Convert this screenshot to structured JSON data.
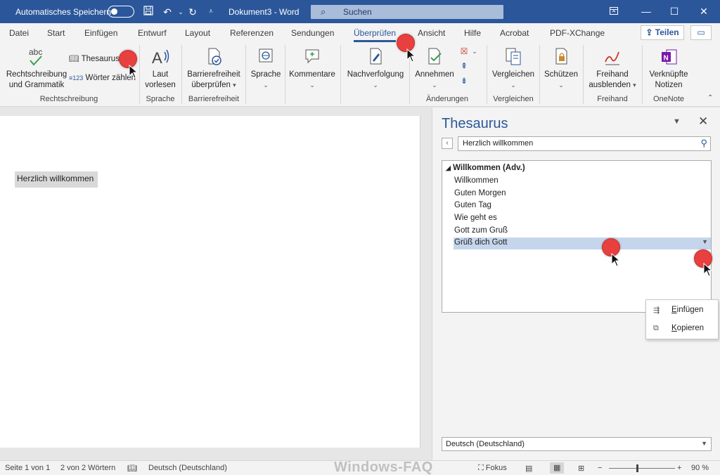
{
  "titlebar": {
    "autosave_label": "Automatisches Speichern",
    "doc_title": "Dokument3 - Word",
    "search_placeholder": "Suchen"
  },
  "tabs": [
    {
      "label": "Datei"
    },
    {
      "label": "Start"
    },
    {
      "label": "Einfügen"
    },
    {
      "label": "Entwurf"
    },
    {
      "label": "Layout"
    },
    {
      "label": "Referenzen"
    },
    {
      "label": "Sendungen"
    },
    {
      "label": "Überprüfen",
      "active": true
    },
    {
      "label": "Ansicht"
    },
    {
      "label": "Hilfe"
    },
    {
      "label": "Acrobat"
    },
    {
      "label": "PDF-XChange"
    }
  ],
  "share_label": "Teilen",
  "ribbon": {
    "spelling_line1": "Rechtschreibung",
    "spelling_line2": "und Grammatik",
    "thesaurus": "Thesaurus",
    "wordcount": "Wörter zählen",
    "read_aloud_line1": "Laut",
    "read_aloud_line2": "vorlesen",
    "accessibility_line1": "Barrierefreiheit",
    "accessibility_line2": "überprüfen",
    "language": "Sprache",
    "comments": "Kommentare",
    "tracking": "Nachverfolgung",
    "accept": "Annehmen",
    "compare": "Vergleichen",
    "protect": "Schützen",
    "ink_line1": "Freihand",
    "ink_line2": "ausblenden",
    "onenote_line1": "Verknüpfte",
    "onenote_line2": "Notizen",
    "groups": {
      "proofing": "Rechtschreibung",
      "speech": "Sprache",
      "accessibility": "Barrierefreiheit",
      "changes": "Änderungen",
      "compare": "Vergleichen",
      "ink": "Freihand",
      "onenote": "OneNote"
    }
  },
  "document": {
    "text": "Herzlich willkommen"
  },
  "thesaurus_pane": {
    "title": "Thesaurus",
    "search_value": "Herzlich willkommen",
    "heading": "Willkommen (Adv.)",
    "results": [
      "Willkommen",
      "Guten Morgen",
      "Guten Tag",
      "Wie geht es",
      "Gott zum Gruß",
      "Grüß dich Gott"
    ],
    "selected_index": 5,
    "context_menu": {
      "insert_prefix": "",
      "insert_accel": "E",
      "insert_rest": "infügen",
      "copy_accel": "K",
      "copy_rest": "opieren"
    },
    "language": "Deutsch (Deutschland)"
  },
  "statusbar": {
    "page": "Seite 1 von 1",
    "words": "2 von 2 Wörtern",
    "language": "Deutsch (Deutschland)",
    "focus": "Fokus",
    "zoom": "90 %",
    "watermark": "Windows-FAQ"
  },
  "colors": {
    "accent": "#2b579a",
    "marker": "#e8403e",
    "selection": "#c5d5ec"
  }
}
